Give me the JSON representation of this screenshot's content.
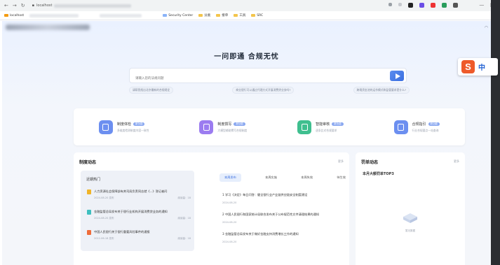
{
  "browser": {
    "url_prefix": "localhost",
    "bookmarks": [
      "Security Center",
      "分类",
      "接单",
      "工具",
      "SRC"
    ],
    "window_controls": [
      "minimize",
      "maximize",
      "close"
    ]
  },
  "hero": {
    "title": "一问即通  合规无忧",
    "search_placeholder": "请输入您的法规问题",
    "hints": [
      "请帮我找出北京最新的合规规定",
      "商业银行可以通过代理方式开展消费贷业务吗?",
      "跨境资金池的运作模式和监管要求是什么?"
    ]
  },
  "features": [
    {
      "title": "制度体检",
      "tag": "新功能",
      "desc": "多维度检测制度内容一致性",
      "color": "#6c8ff0"
    },
    {
      "title": "制度撰写",
      "tag": "新功能",
      "desc": "大模型辅助撰写合规制度",
      "color": "#9b7cf0"
    },
    {
      "title": "智能审核",
      "tag": "新功能",
      "desc": "逐条比对合规要求",
      "color": "#3fbf8f"
    },
    {
      "title": "合规指引",
      "tag": "新功能",
      "desc": "行业合规要点一站查询",
      "color": "#6c8ff0"
    }
  ],
  "policy": {
    "title": "制度动态",
    "more": "更多",
    "recent_title": "近期热门",
    "recent": [
      {
        "title": "人力资源社会保障部有关司局负责同志就《...》答记者问",
        "date": "2024-08-20 发布",
        "count": "阅读量：18",
        "color": "#f0b429"
      },
      {
        "title": "金融监管总局发布关于银行业机构开展消费贷业务的通知",
        "date": "2024-08-20 发布",
        "count": "阅读量：18",
        "color": "#3fbfbf"
      },
      {
        "title": "中国人民银行关于银行重要风险事件的通报",
        "date": "2012-06-18 发布",
        "count": "阅读量：18",
        "color": "#ef6c3a"
      }
    ],
    "tabs": [
      "本周发布",
      "本周实施",
      "本周失效",
      "待生效"
    ],
    "news": [
      {
        "title": "1  学习《决定》每日问答：健全银行业产业链供应链安全制度建设",
        "date": "2024-08-20"
      },
      {
        "title": "2  中国人民银行和国家统计局联合发布关于公布规范性文件清理结果的通知",
        "date": "2024-08-20"
      },
      {
        "title": "3  金融监管总局发布关于做好金融支持消费增长工作的通知",
        "date": "2024-08-20"
      }
    ]
  },
  "penalty": {
    "title": "罚单动态",
    "more": "更多",
    "subtitle": "本月大额罚单TOP3",
    "empty": "暂无数据"
  },
  "ime": {
    "letter": "S",
    "lang": "中"
  }
}
